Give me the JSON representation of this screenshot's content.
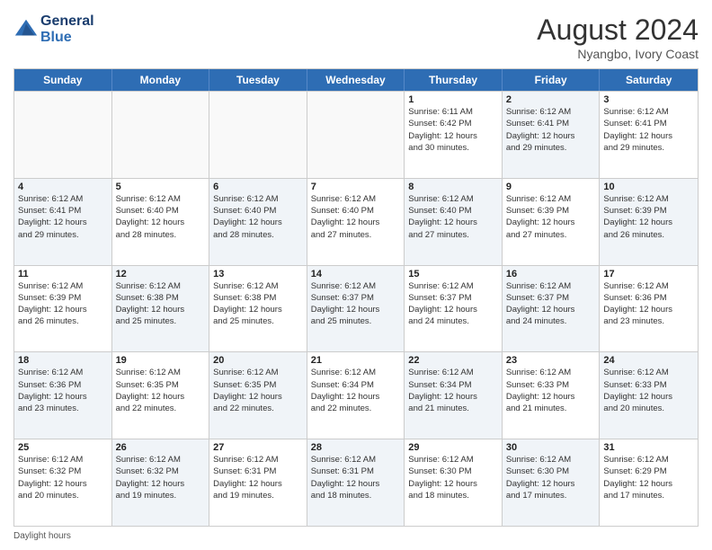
{
  "header": {
    "logo_line1": "General",
    "logo_line2": "Blue",
    "main_title": "August 2024",
    "subtitle": "Nyangbo, Ivory Coast"
  },
  "days_of_week": [
    "Sunday",
    "Monday",
    "Tuesday",
    "Wednesday",
    "Thursday",
    "Friday",
    "Saturday"
  ],
  "footer": "Daylight hours",
  "weeks": [
    [
      {
        "day": "",
        "info": "",
        "shaded": false
      },
      {
        "day": "",
        "info": "",
        "shaded": false
      },
      {
        "day": "",
        "info": "",
        "shaded": false
      },
      {
        "day": "",
        "info": "",
        "shaded": false
      },
      {
        "day": "1",
        "info": "Sunrise: 6:11 AM\nSunset: 6:42 PM\nDaylight: 12 hours\nand 30 minutes.",
        "shaded": false
      },
      {
        "day": "2",
        "info": "Sunrise: 6:12 AM\nSunset: 6:41 PM\nDaylight: 12 hours\nand 29 minutes.",
        "shaded": true
      },
      {
        "day": "3",
        "info": "Sunrise: 6:12 AM\nSunset: 6:41 PM\nDaylight: 12 hours\nand 29 minutes.",
        "shaded": false
      }
    ],
    [
      {
        "day": "4",
        "info": "Sunrise: 6:12 AM\nSunset: 6:41 PM\nDaylight: 12 hours\nand 29 minutes.",
        "shaded": true
      },
      {
        "day": "5",
        "info": "Sunrise: 6:12 AM\nSunset: 6:40 PM\nDaylight: 12 hours\nand 28 minutes.",
        "shaded": false
      },
      {
        "day": "6",
        "info": "Sunrise: 6:12 AM\nSunset: 6:40 PM\nDaylight: 12 hours\nand 28 minutes.",
        "shaded": true
      },
      {
        "day": "7",
        "info": "Sunrise: 6:12 AM\nSunset: 6:40 PM\nDaylight: 12 hours\nand 27 minutes.",
        "shaded": false
      },
      {
        "day": "8",
        "info": "Sunrise: 6:12 AM\nSunset: 6:40 PM\nDaylight: 12 hours\nand 27 minutes.",
        "shaded": true
      },
      {
        "day": "9",
        "info": "Sunrise: 6:12 AM\nSunset: 6:39 PM\nDaylight: 12 hours\nand 27 minutes.",
        "shaded": false
      },
      {
        "day": "10",
        "info": "Sunrise: 6:12 AM\nSunset: 6:39 PM\nDaylight: 12 hours\nand 26 minutes.",
        "shaded": true
      }
    ],
    [
      {
        "day": "11",
        "info": "Sunrise: 6:12 AM\nSunset: 6:39 PM\nDaylight: 12 hours\nand 26 minutes.",
        "shaded": false
      },
      {
        "day": "12",
        "info": "Sunrise: 6:12 AM\nSunset: 6:38 PM\nDaylight: 12 hours\nand 25 minutes.",
        "shaded": true
      },
      {
        "day": "13",
        "info": "Sunrise: 6:12 AM\nSunset: 6:38 PM\nDaylight: 12 hours\nand 25 minutes.",
        "shaded": false
      },
      {
        "day": "14",
        "info": "Sunrise: 6:12 AM\nSunset: 6:37 PM\nDaylight: 12 hours\nand 25 minutes.",
        "shaded": true
      },
      {
        "day": "15",
        "info": "Sunrise: 6:12 AM\nSunset: 6:37 PM\nDaylight: 12 hours\nand 24 minutes.",
        "shaded": false
      },
      {
        "day": "16",
        "info": "Sunrise: 6:12 AM\nSunset: 6:37 PM\nDaylight: 12 hours\nand 24 minutes.",
        "shaded": true
      },
      {
        "day": "17",
        "info": "Sunrise: 6:12 AM\nSunset: 6:36 PM\nDaylight: 12 hours\nand 23 minutes.",
        "shaded": false
      }
    ],
    [
      {
        "day": "18",
        "info": "Sunrise: 6:12 AM\nSunset: 6:36 PM\nDaylight: 12 hours\nand 23 minutes.",
        "shaded": true
      },
      {
        "day": "19",
        "info": "Sunrise: 6:12 AM\nSunset: 6:35 PM\nDaylight: 12 hours\nand 22 minutes.",
        "shaded": false
      },
      {
        "day": "20",
        "info": "Sunrise: 6:12 AM\nSunset: 6:35 PM\nDaylight: 12 hours\nand 22 minutes.",
        "shaded": true
      },
      {
        "day": "21",
        "info": "Sunrise: 6:12 AM\nSunset: 6:34 PM\nDaylight: 12 hours\nand 22 minutes.",
        "shaded": false
      },
      {
        "day": "22",
        "info": "Sunrise: 6:12 AM\nSunset: 6:34 PM\nDaylight: 12 hours\nand 21 minutes.",
        "shaded": true
      },
      {
        "day": "23",
        "info": "Sunrise: 6:12 AM\nSunset: 6:33 PM\nDaylight: 12 hours\nand 21 minutes.",
        "shaded": false
      },
      {
        "day": "24",
        "info": "Sunrise: 6:12 AM\nSunset: 6:33 PM\nDaylight: 12 hours\nand 20 minutes.",
        "shaded": true
      }
    ],
    [
      {
        "day": "25",
        "info": "Sunrise: 6:12 AM\nSunset: 6:32 PM\nDaylight: 12 hours\nand 20 minutes.",
        "shaded": false
      },
      {
        "day": "26",
        "info": "Sunrise: 6:12 AM\nSunset: 6:32 PM\nDaylight: 12 hours\nand 19 minutes.",
        "shaded": true
      },
      {
        "day": "27",
        "info": "Sunrise: 6:12 AM\nSunset: 6:31 PM\nDaylight: 12 hours\nand 19 minutes.",
        "shaded": false
      },
      {
        "day": "28",
        "info": "Sunrise: 6:12 AM\nSunset: 6:31 PM\nDaylight: 12 hours\nand 18 minutes.",
        "shaded": true
      },
      {
        "day": "29",
        "info": "Sunrise: 6:12 AM\nSunset: 6:30 PM\nDaylight: 12 hours\nand 18 minutes.",
        "shaded": false
      },
      {
        "day": "30",
        "info": "Sunrise: 6:12 AM\nSunset: 6:30 PM\nDaylight: 12 hours\nand 17 minutes.",
        "shaded": true
      },
      {
        "day": "31",
        "info": "Sunrise: 6:12 AM\nSunset: 6:29 PM\nDaylight: 12 hours\nand 17 minutes.",
        "shaded": false
      }
    ]
  ]
}
